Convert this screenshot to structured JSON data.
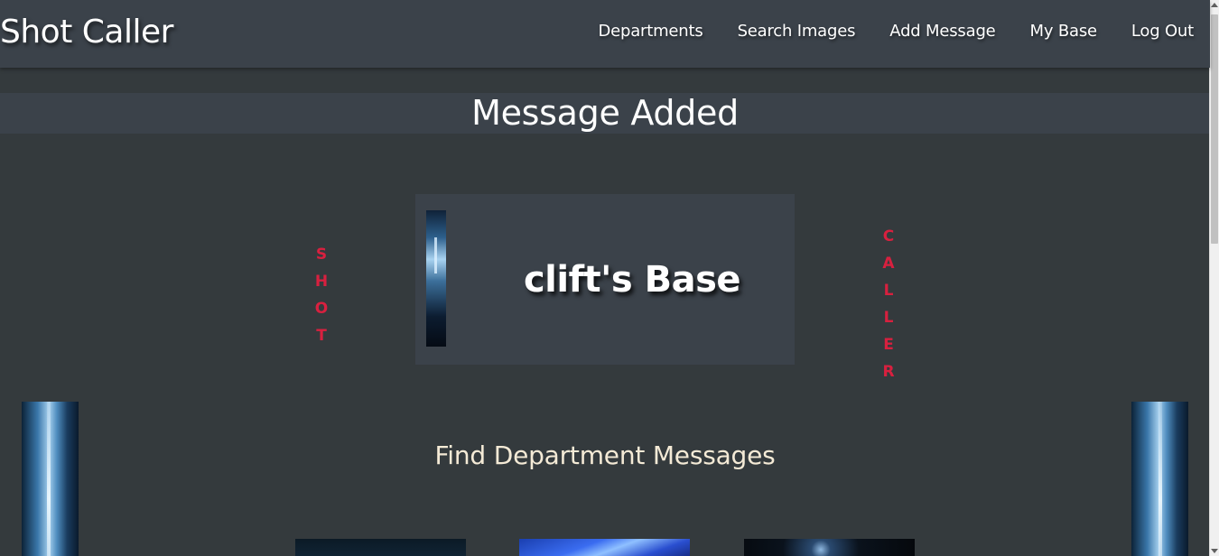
{
  "brand": "Shot Caller",
  "nav": {
    "departments": "Departments",
    "search_images": "Search Images",
    "add_message": "Add Message",
    "my_base": "My Base",
    "log_out": "Log Out"
  },
  "page_title": "Message Added",
  "side_words": {
    "left": [
      "S",
      "H",
      "O",
      "T"
    ],
    "right": [
      "C",
      "A",
      "L",
      "L",
      "E",
      "R"
    ]
  },
  "base_card": {
    "title": "clift's Base"
  },
  "section_heading": "Find Department Messages",
  "colors": {
    "background": "#343a3d",
    "navbar": "#3b424a",
    "accent_red": "#d8203f",
    "heading_cream": "#f4ead6",
    "text_white": "#ffffff"
  }
}
